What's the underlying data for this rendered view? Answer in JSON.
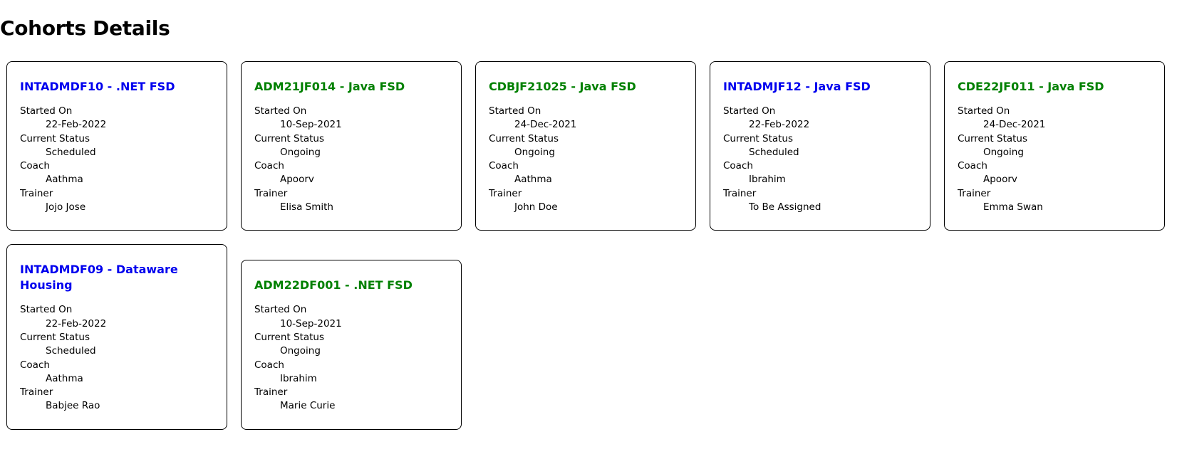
{
  "page": {
    "title": "Cohorts Details"
  },
  "labels": {
    "started_on": "Started On",
    "current_status": "Current Status",
    "coach": "Coach",
    "trainer": "Trainer"
  },
  "colors": {
    "scheduled_title": "#0000ee",
    "ongoing_title": "#008000",
    "card_border": "#000000"
  },
  "cohorts": [
    {
      "title": "INTADMDF10 - .NET FSD",
      "started_on": "22-Feb-2022",
      "current_status": "Scheduled",
      "coach": "Aathma",
      "trainer": "Jojo Jose"
    },
    {
      "title": "ADM21JF014 - Java FSD",
      "started_on": "10-Sep-2021",
      "current_status": "Ongoing",
      "coach": "Apoorv",
      "trainer": "Elisa Smith"
    },
    {
      "title": "CDBJF21025 - Java FSD",
      "started_on": "24-Dec-2021",
      "current_status": "Ongoing",
      "coach": "Aathma",
      "trainer": "John Doe"
    },
    {
      "title": "INTADMJF12 - Java FSD",
      "started_on": "22-Feb-2022",
      "current_status": "Scheduled",
      "coach": "Ibrahim",
      "trainer": "To Be Assigned"
    },
    {
      "title": "CDE22JF011 - Java FSD",
      "started_on": "24-Dec-2021",
      "current_status": "Ongoing",
      "coach": "Apoorv",
      "trainer": "Emma Swan"
    },
    {
      "title": "INTADMDF09 - Dataware Housing",
      "started_on": "22-Feb-2022",
      "current_status": "Scheduled",
      "coach": "Aathma",
      "trainer": "Babjee Rao"
    },
    {
      "title": "ADM22DF001 - .NET FSD",
      "started_on": "10-Sep-2021",
      "current_status": "Ongoing",
      "coach": "Ibrahim",
      "trainer": "Marie Curie"
    }
  ]
}
